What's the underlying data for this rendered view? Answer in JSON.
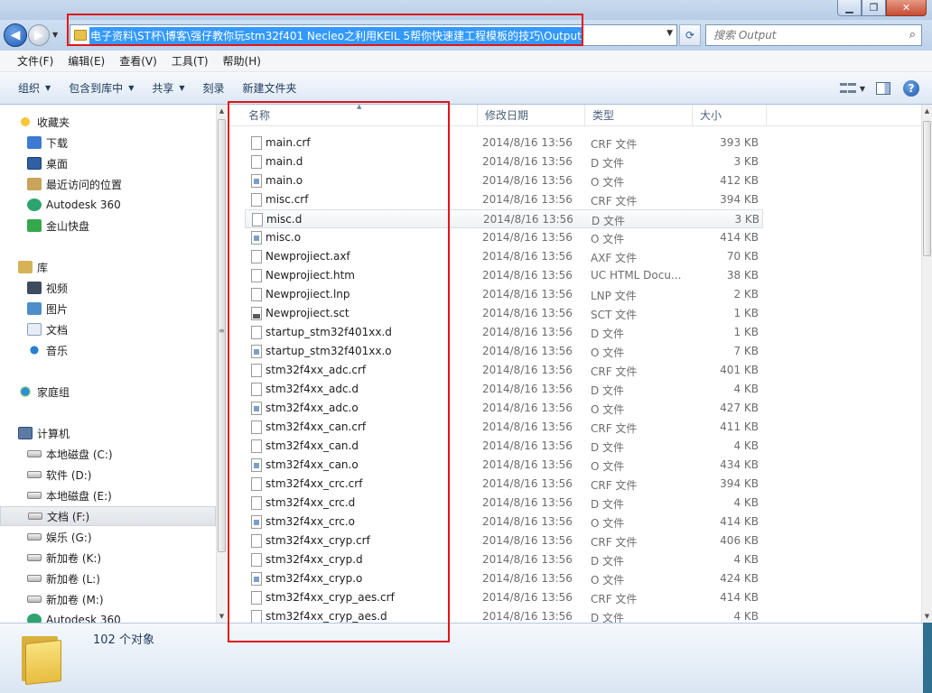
{
  "window": {
    "min_label": "▁",
    "max_label": "❐",
    "close_label": "✕"
  },
  "address": {
    "path": "电子资料\\ST杯\\博客\\强仔教你玩stm32f401 Necleo之利用KEIL 5帮你快速建工程模板的技巧\\Output",
    "search_placeholder": "搜索 Output"
  },
  "icons": {
    "back": "back-arrow-icon",
    "forward": "forward-arrow-icon",
    "refresh": "refresh-icon",
    "search": "magnifier-icon",
    "help": "help-icon"
  },
  "menu": [
    "文件(F)",
    "编辑(E)",
    "查看(V)",
    "工具(T)",
    "帮助(H)"
  ],
  "toolbar": {
    "organize": "组织",
    "include_library": "包含到库中",
    "share": "共享",
    "burn": "刻录",
    "new_folder": "新建文件夹",
    "help_glyph": "?"
  },
  "nav": {
    "favorites": {
      "label": "收藏夹",
      "items": [
        "下载",
        "桌面",
        "最近访问的位置",
        "Autodesk 360",
        "金山快盘"
      ]
    },
    "libraries": {
      "label": "库",
      "items": [
        "视频",
        "图片",
        "文档",
        "音乐"
      ]
    },
    "homegroup": {
      "label": "家庭组"
    },
    "computer": {
      "label": "计算机",
      "items": [
        "本地磁盘 (C:)",
        "软件 (D:)",
        "本地磁盘 (E:)",
        "文档 (F:)",
        "娱乐 (G:)",
        "新加卷 (K:)",
        "新加卷 (L:)",
        "新加卷 (M:)",
        "Autodesk 360"
      ],
      "selected_index": 3
    }
  },
  "columns": {
    "name": "名称",
    "date": "修改日期",
    "type": "类型",
    "size": "大小"
  },
  "files": [
    {
      "name": "main.crf",
      "date": "2014/8/16 13:56",
      "type": "CRF 文件",
      "size": "393 KB",
      "icon": "file-icon"
    },
    {
      "name": "main.d",
      "date": "2014/8/16 13:56",
      "type": "D 文件",
      "size": "3 KB",
      "icon": "file-icon"
    },
    {
      "name": "main.o",
      "date": "2014/8/16 13:56",
      "type": "O 文件",
      "size": "412 KB",
      "icon": "object-file-icon"
    },
    {
      "name": "misc.crf",
      "date": "2014/8/16 13:56",
      "type": "CRF 文件",
      "size": "394 KB",
      "icon": "file-icon"
    },
    {
      "name": "misc.d",
      "date": "2014/8/16 13:56",
      "type": "D 文件",
      "size": "3 KB",
      "icon": "file-icon"
    },
    {
      "name": "misc.o",
      "date": "2014/8/16 13:56",
      "type": "O 文件",
      "size": "414 KB",
      "icon": "object-file-icon"
    },
    {
      "name": "Newprojiect.axf",
      "date": "2014/8/16 13:56",
      "type": "AXF 文件",
      "size": "70 KB",
      "icon": "file-icon"
    },
    {
      "name": "Newprojiect.htm",
      "date": "2014/8/16 13:56",
      "type": "UC HTML Docu...",
      "size": "38 KB",
      "icon": "file-icon"
    },
    {
      "name": "Newprojiect.lnp",
      "date": "2014/8/16 13:56",
      "type": "LNP 文件",
      "size": "2 KB",
      "icon": "file-icon"
    },
    {
      "name": "Newprojiect.sct",
      "date": "2014/8/16 13:56",
      "type": "SCT 文件",
      "size": "1 KB",
      "icon": "sct-file-icon"
    },
    {
      "name": "startup_stm32f401xx.d",
      "date": "2014/8/16 13:56",
      "type": "D 文件",
      "size": "1 KB",
      "icon": "file-icon"
    },
    {
      "name": "startup_stm32f401xx.o",
      "date": "2014/8/16 13:56",
      "type": "O 文件",
      "size": "7 KB",
      "icon": "object-file-icon"
    },
    {
      "name": "stm32f4xx_adc.crf",
      "date": "2014/8/16 13:56",
      "type": "CRF 文件",
      "size": "401 KB",
      "icon": "file-icon"
    },
    {
      "name": "stm32f4xx_adc.d",
      "date": "2014/8/16 13:56",
      "type": "D 文件",
      "size": "4 KB",
      "icon": "file-icon"
    },
    {
      "name": "stm32f4xx_adc.o",
      "date": "2014/8/16 13:56",
      "type": "O 文件",
      "size": "427 KB",
      "icon": "object-file-icon"
    },
    {
      "name": "stm32f4xx_can.crf",
      "date": "2014/8/16 13:56",
      "type": "CRF 文件",
      "size": "411 KB",
      "icon": "file-icon"
    },
    {
      "name": "stm32f4xx_can.d",
      "date": "2014/8/16 13:56",
      "type": "D 文件",
      "size": "4 KB",
      "icon": "file-icon"
    },
    {
      "name": "stm32f4xx_can.o",
      "date": "2014/8/16 13:56",
      "type": "O 文件",
      "size": "434 KB",
      "icon": "object-file-icon"
    },
    {
      "name": "stm32f4xx_crc.crf",
      "date": "2014/8/16 13:56",
      "type": "CRF 文件",
      "size": "394 KB",
      "icon": "file-icon"
    },
    {
      "name": "stm32f4xx_crc.d",
      "date": "2014/8/16 13:56",
      "type": "D 文件",
      "size": "4 KB",
      "icon": "file-icon"
    },
    {
      "name": "stm32f4xx_crc.o",
      "date": "2014/8/16 13:56",
      "type": "O 文件",
      "size": "414 KB",
      "icon": "object-file-icon"
    },
    {
      "name": "stm32f4xx_cryp.crf",
      "date": "2014/8/16 13:56",
      "type": "CRF 文件",
      "size": "406 KB",
      "icon": "file-icon"
    },
    {
      "name": "stm32f4xx_cryp.d",
      "date": "2014/8/16 13:56",
      "type": "D 文件",
      "size": "4 KB",
      "icon": "file-icon"
    },
    {
      "name": "stm32f4xx_cryp.o",
      "date": "2014/8/16 13:56",
      "type": "O 文件",
      "size": "424 KB",
      "icon": "object-file-icon"
    },
    {
      "name": "stm32f4xx_cryp_aes.crf",
      "date": "2014/8/16 13:56",
      "type": "CRF 文件",
      "size": "414 KB",
      "icon": "file-icon"
    },
    {
      "name": "stm32f4xx_cryp_aes.d",
      "date": "2014/8/16 13:56",
      "type": "D 文件",
      "size": "4 KB",
      "icon": "file-icon"
    }
  ],
  "selected_file_index": 4,
  "status": {
    "count": "102 个对象"
  },
  "annotation_color": "#e21616"
}
